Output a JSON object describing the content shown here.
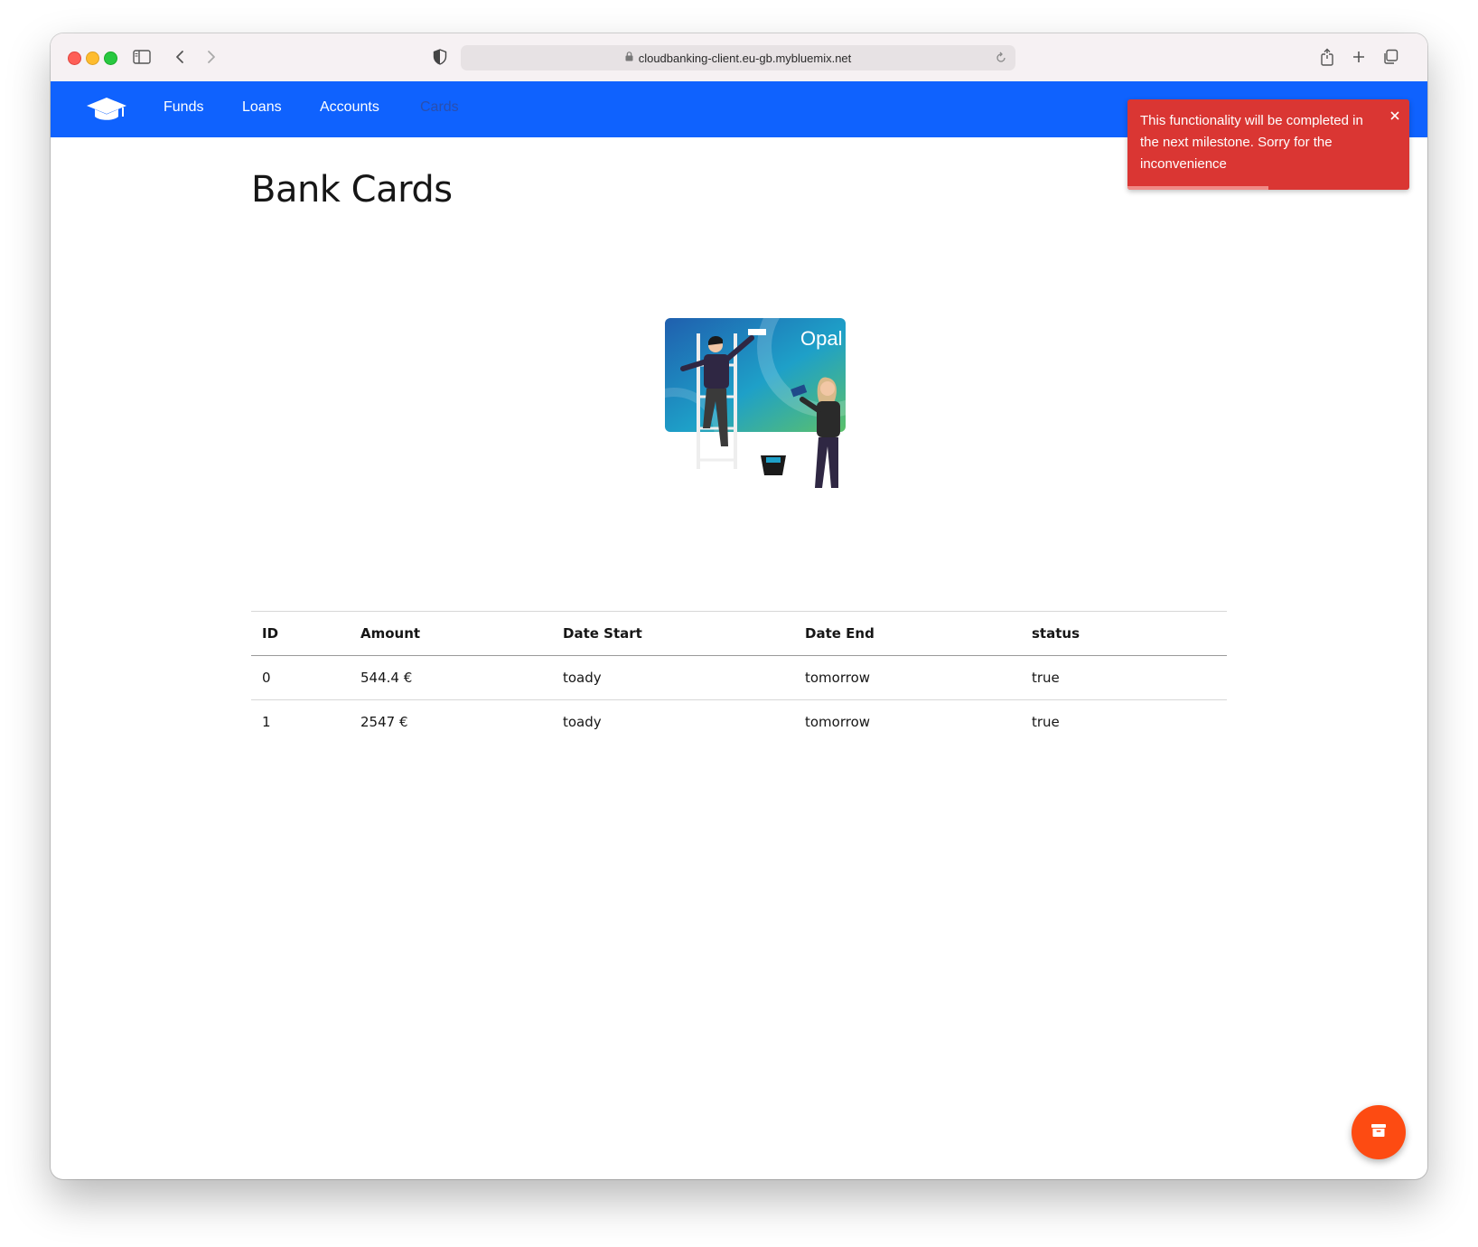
{
  "browser": {
    "url": "cloudbanking-client.eu-gb.mybluemix.net"
  },
  "navbar": {
    "brand_icon": "graduation-cap-icon",
    "brand_color": "#0f62fe",
    "links": [
      {
        "label": "Funds"
      },
      {
        "label": "Loans"
      },
      {
        "label": "Accounts"
      },
      {
        "label": "Cards"
      }
    ]
  },
  "page": {
    "title": "Bank Cards",
    "illustration_logo": "Opal"
  },
  "table": {
    "headers": [
      "ID",
      "Amount",
      "Date Start",
      "Date End",
      "status"
    ],
    "rows": [
      [
        "0",
        "544.4 €",
        "toady",
        "tomorrow",
        "true"
      ],
      [
        "1",
        "2547 €",
        "toady",
        "tomorrow",
        "true"
      ]
    ]
  },
  "toast": {
    "message": "This functionality will be completed in the next milestone. Sorry for the inconvenience",
    "color": "#da3633",
    "progress": 0.5
  },
  "fab": {
    "icon": "archive-icon",
    "color": "#fd4b12"
  }
}
